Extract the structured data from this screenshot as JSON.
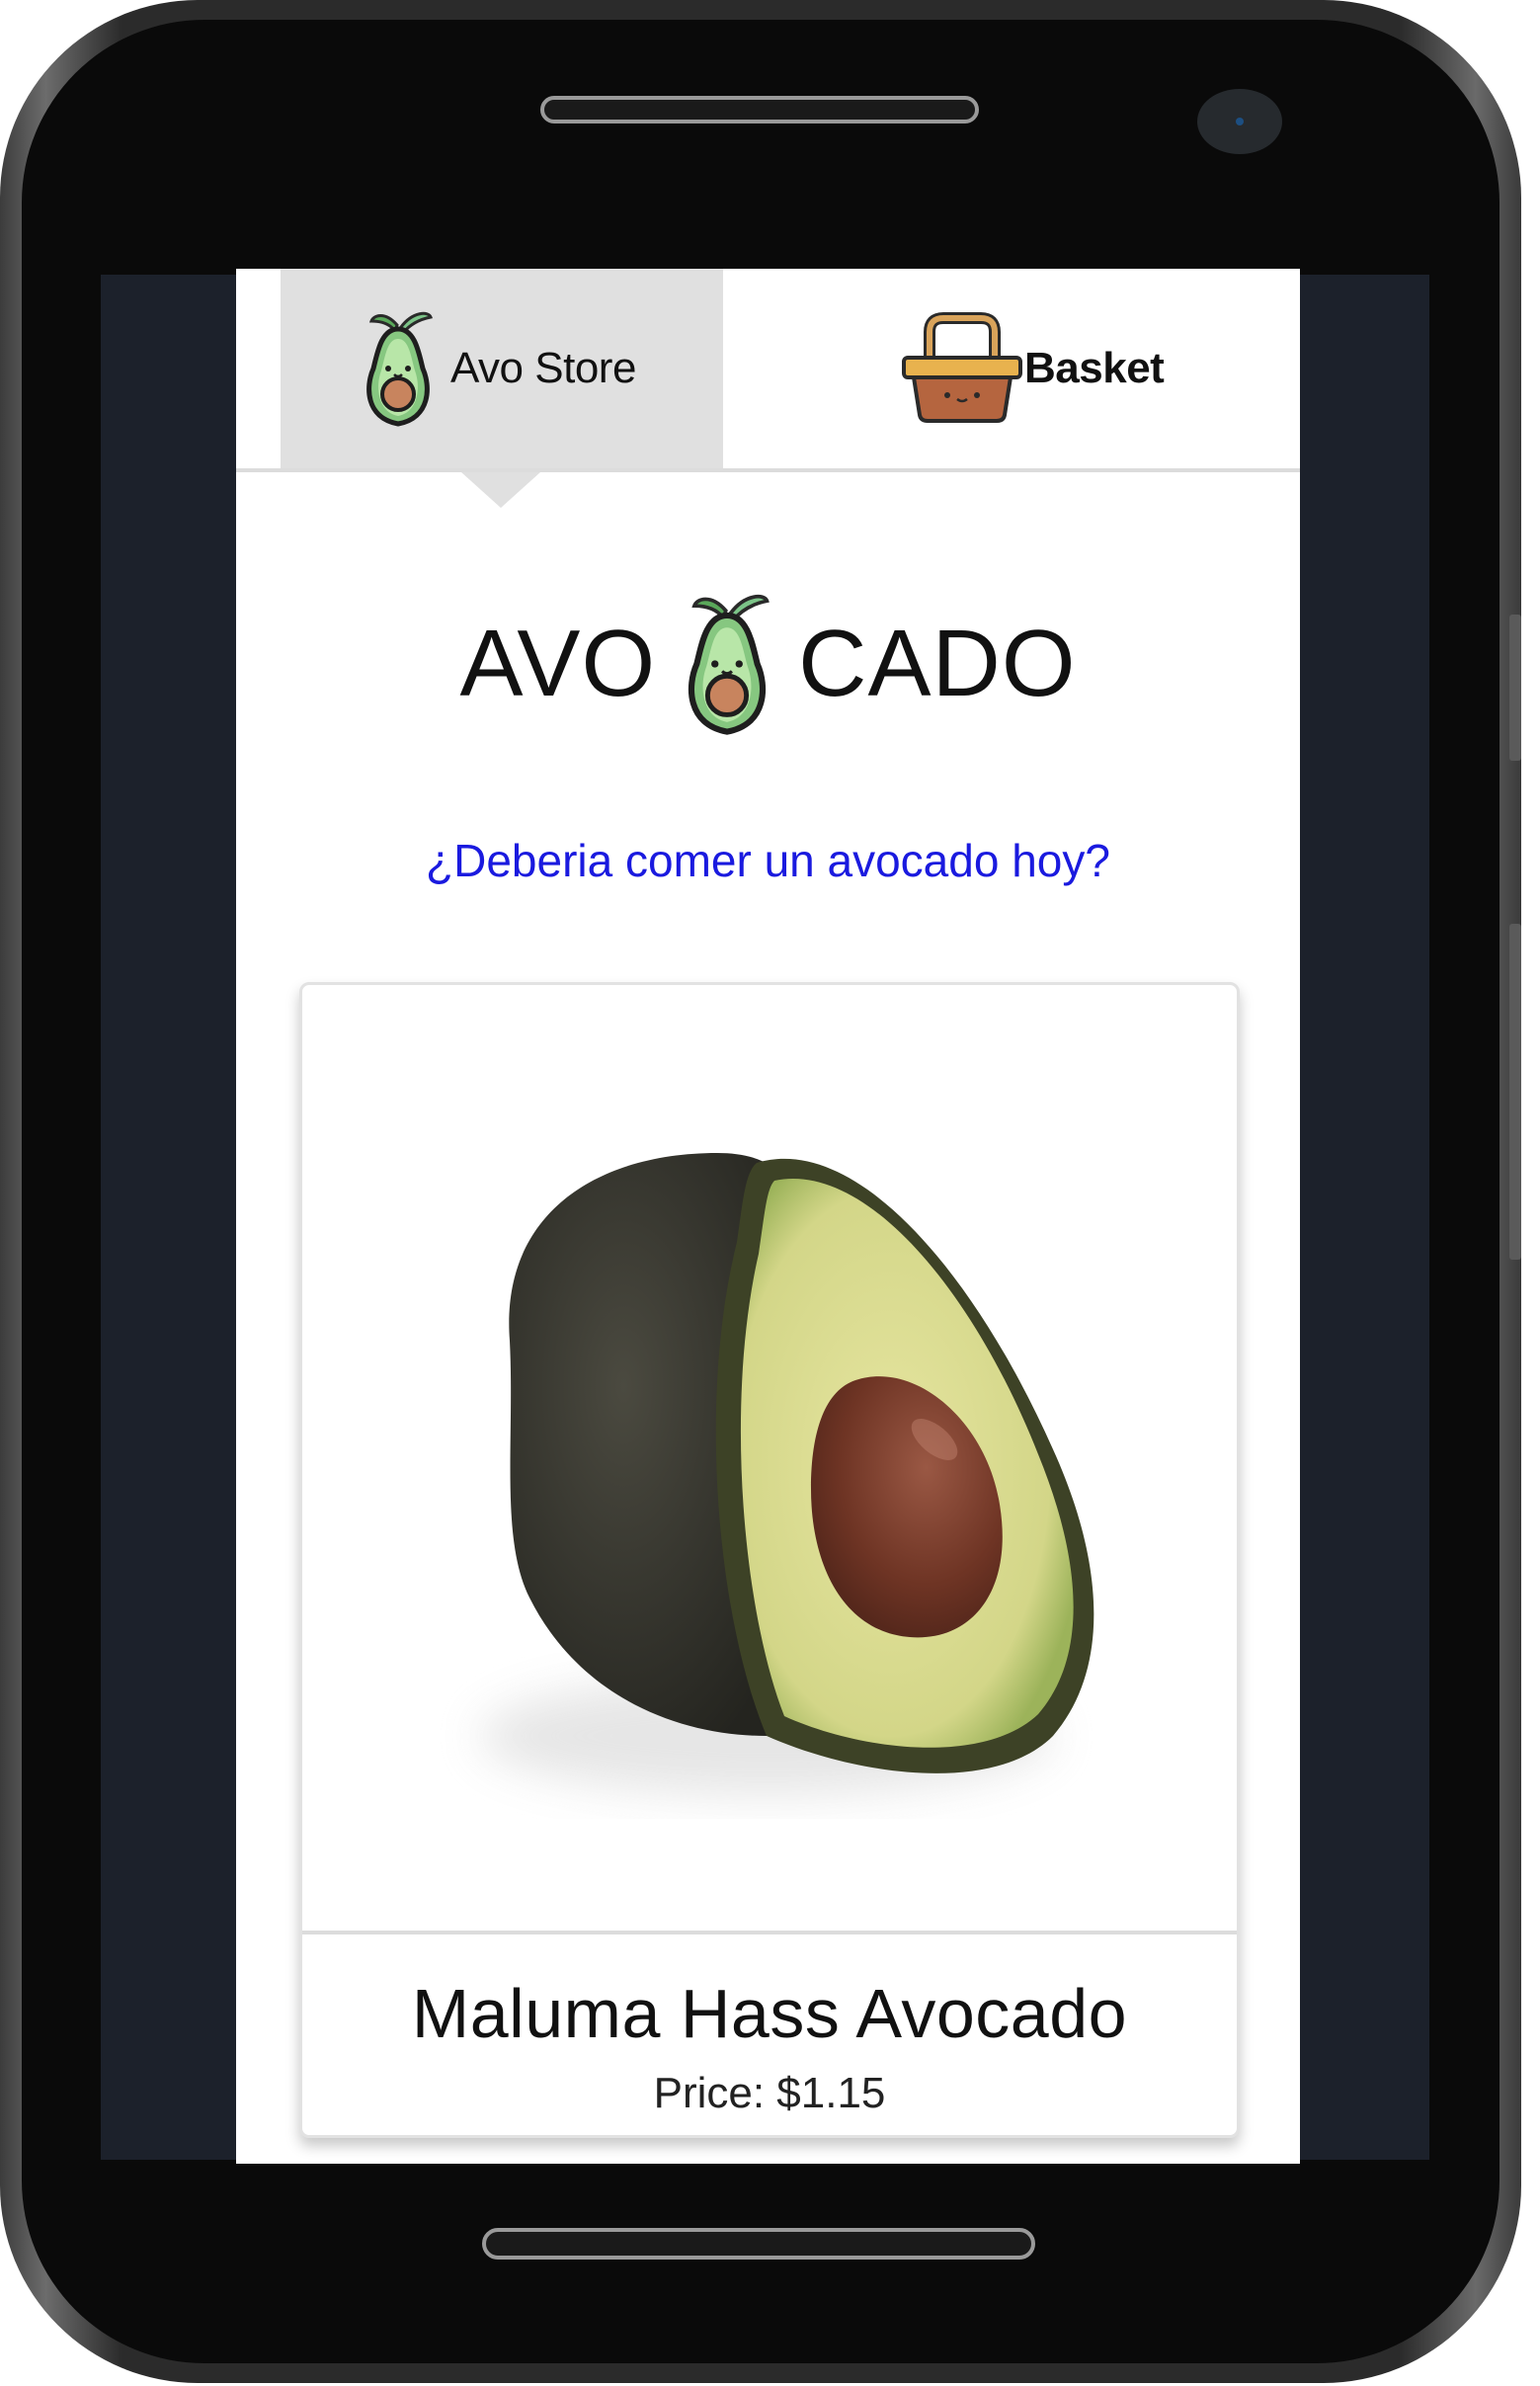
{
  "nav": {
    "store_label": "Avo Store",
    "basket_label": "Basket"
  },
  "brand": {
    "left_word": "AVO",
    "right_word": "CADO"
  },
  "prompt_link": "¿Deberia comer un avocado hoy?",
  "product": {
    "name": "Maluma Hass Avocado",
    "price": "Price: $1.15"
  },
  "icons": {
    "store": "avocado-icon",
    "basket": "basket-icon",
    "brand": "avocado-icon"
  },
  "colors": {
    "active_tab": "#e0e0e0",
    "link": "#1a1adf",
    "avocado_green": "#86c780",
    "pit_brown": "#c8845e"
  }
}
